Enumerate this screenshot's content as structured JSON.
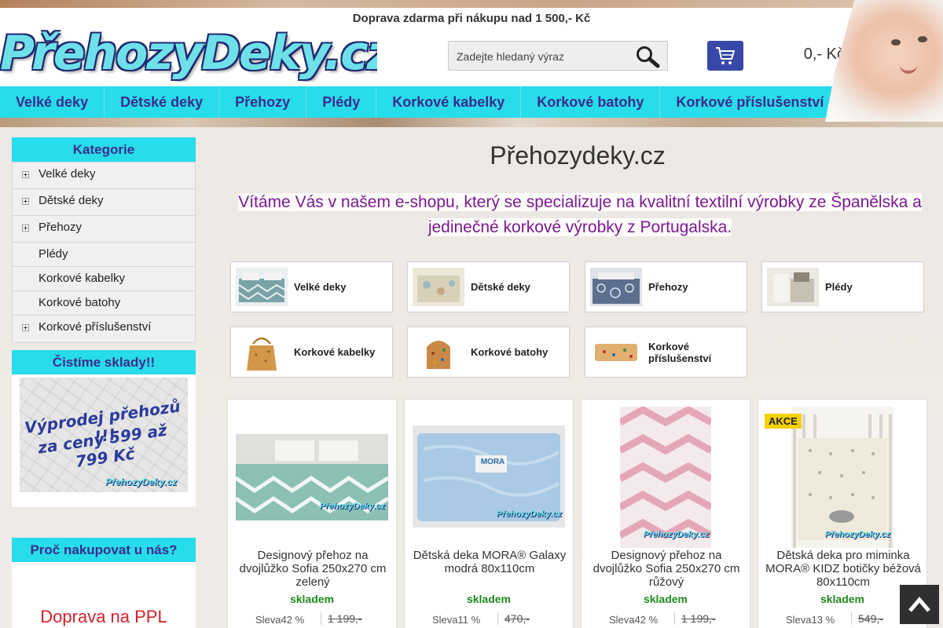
{
  "header": {
    "shipping_note": "Doprava zdarma při nákupu nad 1 500,- Kč",
    "logo_text": "PřehozyDeky.cz",
    "search_placeholder": "Zadejte hledaný výraz",
    "cart_total": "0,- Kč",
    "icons": {
      "search": "search-icon",
      "cart": "cart-icon"
    }
  },
  "nav": {
    "items": [
      "Velké deky",
      "Dětské deky",
      "Přehozy",
      "Plédy",
      "Korkové kabelky",
      "Korkové batohy",
      "Korkové příslušenství"
    ]
  },
  "sidebar": {
    "categories_title": "Kategorie",
    "categories": [
      {
        "label": "Velké deky",
        "expandable": true
      },
      {
        "label": "Dětské deky",
        "expandable": true
      },
      {
        "label": "Přehozy",
        "expandable": true
      },
      {
        "label": "Plédy",
        "expandable": false
      },
      {
        "label": "Korkové kabelky",
        "expandable": false
      },
      {
        "label": "Korkové batohy",
        "expandable": false
      },
      {
        "label": "Korkové příslušenství",
        "expandable": true
      }
    ],
    "promo_title": "Čistíme sklady!!",
    "promo_line1": "Výprodej přehozů !!!",
    "promo_line2": "za ceny 599 až 799 Kč",
    "promo_watermark": "PřehozyDeky.cz",
    "why_title": "Proč nakupovat u nás?",
    "why_text": "Doprava na PPL"
  },
  "main": {
    "title": "Přehozydeky.cz",
    "welcome": "Vítáme Vás v našem e-shopu, který se specializuje na kvalitní textilní výrobky ze Španělska a jedinečné korkové výrobky z Portugalska.",
    "category_tiles": [
      "Velké deky",
      "Dětské deky",
      "Přehozy",
      "Plédy",
      "Korkové kabelky",
      "Korkové batohy",
      "Korkové příslušenství"
    ],
    "products": [
      {
        "name": "Designový přehoz na dvojlůžko Sofia 250x270 cm zelený",
        "stock": "skladem",
        "discount": "Sleva42 %",
        "old_price": "1 199,-",
        "badge": "",
        "watermark": "PřehozyDeky.cz"
      },
      {
        "name": "Dětská deka MORA® Galaxy modrá 80x110cm",
        "stock": "skladem",
        "discount": "Sleva11 %",
        "old_price": "470,-",
        "badge": "",
        "watermark": "PřehozyDeky.cz",
        "label": "MORA"
      },
      {
        "name": "Designový přehoz na dvojlůžko Sofia 250x270 cm růžový",
        "stock": "skladem",
        "discount": "Sleva42 %",
        "old_price": "1 199,-",
        "badge": "",
        "watermark": "PřehozyDeky.cz"
      },
      {
        "name": "Dětská deka pro miminka MORA® KIDZ botičky béžová 80x110cm",
        "stock": "skladem",
        "discount": "Sleva13 %",
        "old_price": "549,-",
        "badge": "AKCE",
        "watermark": "PřehozyDeky.cz"
      }
    ]
  },
  "colors": {
    "accent": "#27dceb",
    "nav_text": "#3b2c8c",
    "welcome_text": "#7b1a8f",
    "stock_green": "#1f8a1f",
    "badge_yellow": "#f5d000",
    "cart_blue": "#3848a8",
    "why_red": "#d0222a"
  }
}
